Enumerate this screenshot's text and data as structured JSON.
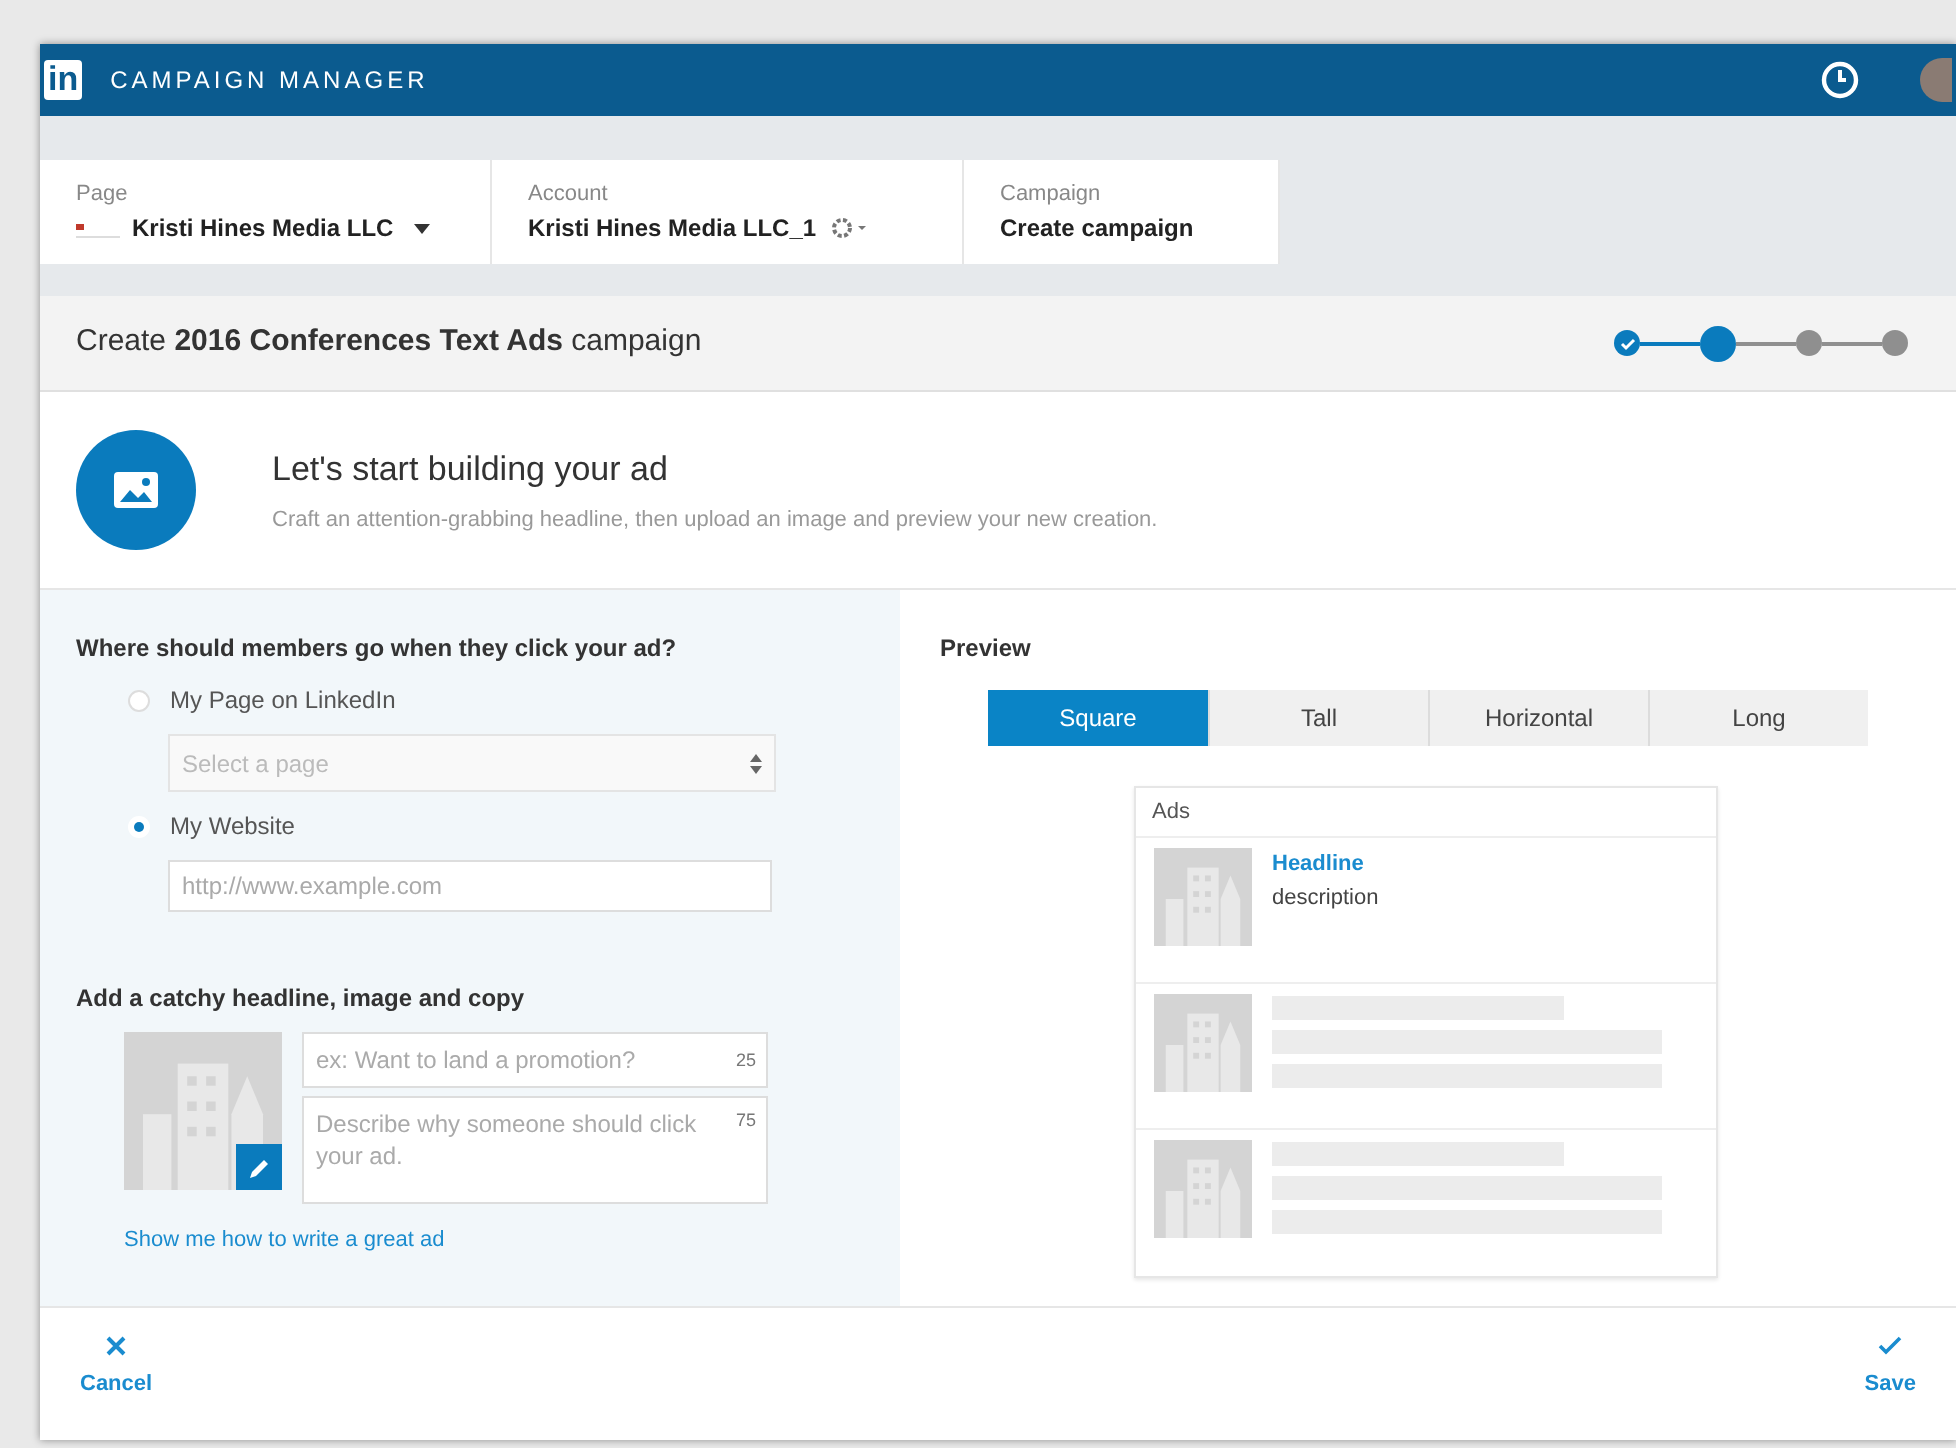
{
  "app_bar": {
    "logo": "in",
    "title": "CAMPAIGN MANAGER"
  },
  "breadcrumbs": [
    {
      "label": "Page",
      "value": "Kristi Hines Media LLC",
      "kind": "page"
    },
    {
      "label": "Account",
      "value": "Kristi Hines Media LLC_1",
      "kind": "account"
    },
    {
      "label": "Campaign",
      "value": "Create campaign",
      "kind": "plain"
    }
  ],
  "campaign_title": "Create **2016 Conferences Text Ads** campaign",
  "steps": [
    {
      "completed": true,
      "selected": false
    },
    {
      "completed": false,
      "selected": true
    },
    {
      "completed": false,
      "selected": false
    },
    {
      "completed": false,
      "selected": false
    }
  ],
  "intro": {
    "heading": "Let's start building your ad",
    "subtext": "Craft an attention-grabbing headline, then upload an image and preview your new creation."
  },
  "destination": {
    "question": "Where should members go when they click your ad?",
    "options": [
      {
        "label": "My Page on LinkedIn",
        "selected": false,
        "kind": "select",
        "placeholder": "Select a page"
      },
      {
        "label": "My Website",
        "selected": true,
        "kind": "text",
        "placeholder": "http://www.example.com"
      }
    ]
  },
  "creative": {
    "heading": "Add a catchy headline, image and copy",
    "headline": {
      "placeholder": "ex: Want to land a promotion?",
      "count": "25"
    },
    "description": {
      "placeholder": "Describe why someone should click your ad.",
      "count": "75"
    },
    "help_link": "Show me how to write a great ad"
  },
  "preview": {
    "heading": "Preview",
    "tabs": [
      {
        "label": "Square",
        "selected": true
      },
      {
        "label": "Tall",
        "selected": false
      },
      {
        "label": "Horizontal",
        "selected": false
      },
      {
        "label": "Long",
        "selected": false
      }
    ],
    "box_title": "Ads",
    "ad_headline": "Headline",
    "ad_description": "description"
  },
  "footer": {
    "cancel": "Cancel",
    "save": "Save"
  }
}
